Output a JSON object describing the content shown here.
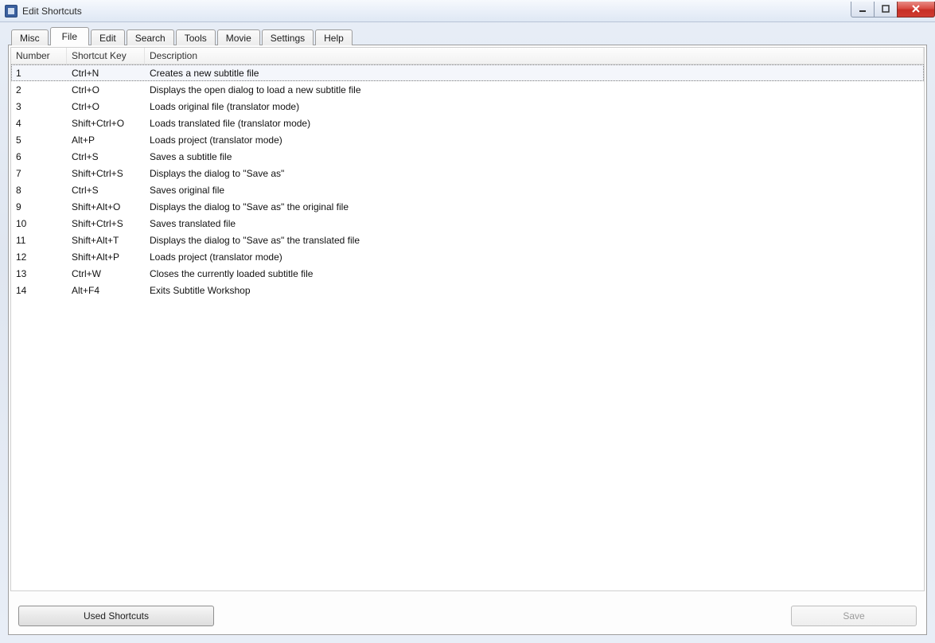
{
  "window": {
    "title": "Edit Shortcuts"
  },
  "tabs": [
    {
      "label": "Misc",
      "active": false
    },
    {
      "label": "File",
      "active": true
    },
    {
      "label": "Edit",
      "active": false
    },
    {
      "label": "Search",
      "active": false
    },
    {
      "label": "Tools",
      "active": false
    },
    {
      "label": "Movie",
      "active": false
    },
    {
      "label": "Settings",
      "active": false
    },
    {
      "label": "Help",
      "active": false
    }
  ],
  "columns": {
    "number": "Number",
    "shortcut": "Shortcut Key",
    "description": "Description"
  },
  "rows": [
    {
      "number": "1",
      "key": "Ctrl+N",
      "desc": "Creates a new subtitle file",
      "selected": true
    },
    {
      "number": "2",
      "key": "Ctrl+O",
      "desc": "Displays the open dialog to load a new subtitle file"
    },
    {
      "number": "3",
      "key": "Ctrl+O",
      "desc": "Loads original file (translator mode)"
    },
    {
      "number": "4",
      "key": "Shift+Ctrl+O",
      "desc": "Loads translated file (translator mode)"
    },
    {
      "number": "5",
      "key": "Alt+P",
      "desc": "Loads project (translator mode)"
    },
    {
      "number": "6",
      "key": "Ctrl+S",
      "desc": "Saves a subtitle file"
    },
    {
      "number": "7",
      "key": "Shift+Ctrl+S",
      "desc": "Displays the dialog to \"Save as\""
    },
    {
      "number": "8",
      "key": "Ctrl+S",
      "desc": "Saves original file"
    },
    {
      "number": "9",
      "key": "Shift+Alt+O",
      "desc": "Displays the dialog to \"Save as\" the original file"
    },
    {
      "number": "10",
      "key": "Shift+Ctrl+S",
      "desc": "Saves translated file"
    },
    {
      "number": "11",
      "key": "Shift+Alt+T",
      "desc": "Displays the dialog to \"Save as\" the translated file"
    },
    {
      "number": "12",
      "key": "Shift+Alt+P",
      "desc": "Loads project (translator mode)"
    },
    {
      "number": "13",
      "key": "Ctrl+W",
      "desc": "Closes the currently loaded subtitle file"
    },
    {
      "number": "14",
      "key": "Alt+F4",
      "desc": "Exits Subtitle Workshop"
    }
  ],
  "buttons": {
    "used_shortcuts": "Used Shortcuts",
    "save": "Save"
  }
}
